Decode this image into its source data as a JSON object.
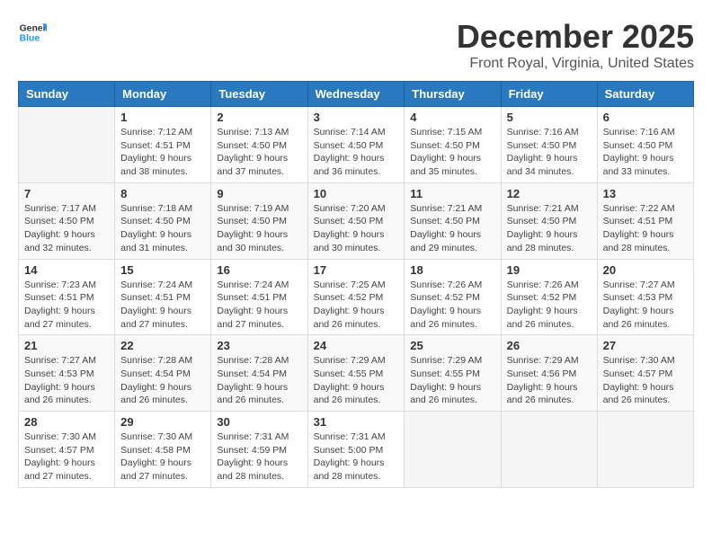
{
  "header": {
    "logo_general": "General",
    "logo_blue": "Blue",
    "month": "December 2025",
    "location": "Front Royal, Virginia, United States"
  },
  "weekdays": [
    "Sunday",
    "Monday",
    "Tuesday",
    "Wednesday",
    "Thursday",
    "Friday",
    "Saturday"
  ],
  "weeks": [
    [
      {
        "day": "",
        "info": ""
      },
      {
        "day": "1",
        "info": "Sunrise: 7:12 AM\nSunset: 4:51 PM\nDaylight: 9 hours\nand 38 minutes."
      },
      {
        "day": "2",
        "info": "Sunrise: 7:13 AM\nSunset: 4:50 PM\nDaylight: 9 hours\nand 37 minutes."
      },
      {
        "day": "3",
        "info": "Sunrise: 7:14 AM\nSunset: 4:50 PM\nDaylight: 9 hours\nand 36 minutes."
      },
      {
        "day": "4",
        "info": "Sunrise: 7:15 AM\nSunset: 4:50 PM\nDaylight: 9 hours\nand 35 minutes."
      },
      {
        "day": "5",
        "info": "Sunrise: 7:16 AM\nSunset: 4:50 PM\nDaylight: 9 hours\nand 34 minutes."
      },
      {
        "day": "6",
        "info": "Sunrise: 7:16 AM\nSunset: 4:50 PM\nDaylight: 9 hours\nand 33 minutes."
      }
    ],
    [
      {
        "day": "7",
        "info": "Sunrise: 7:17 AM\nSunset: 4:50 PM\nDaylight: 9 hours\nand 32 minutes."
      },
      {
        "day": "8",
        "info": "Sunrise: 7:18 AM\nSunset: 4:50 PM\nDaylight: 9 hours\nand 31 minutes."
      },
      {
        "day": "9",
        "info": "Sunrise: 7:19 AM\nSunset: 4:50 PM\nDaylight: 9 hours\nand 30 minutes."
      },
      {
        "day": "10",
        "info": "Sunrise: 7:20 AM\nSunset: 4:50 PM\nDaylight: 9 hours\nand 30 minutes."
      },
      {
        "day": "11",
        "info": "Sunrise: 7:21 AM\nSunset: 4:50 PM\nDaylight: 9 hours\nand 29 minutes."
      },
      {
        "day": "12",
        "info": "Sunrise: 7:21 AM\nSunset: 4:50 PM\nDaylight: 9 hours\nand 28 minutes."
      },
      {
        "day": "13",
        "info": "Sunrise: 7:22 AM\nSunset: 4:51 PM\nDaylight: 9 hours\nand 28 minutes."
      }
    ],
    [
      {
        "day": "14",
        "info": "Sunrise: 7:23 AM\nSunset: 4:51 PM\nDaylight: 9 hours\nand 27 minutes."
      },
      {
        "day": "15",
        "info": "Sunrise: 7:24 AM\nSunset: 4:51 PM\nDaylight: 9 hours\nand 27 minutes."
      },
      {
        "day": "16",
        "info": "Sunrise: 7:24 AM\nSunset: 4:51 PM\nDaylight: 9 hours\nand 27 minutes."
      },
      {
        "day": "17",
        "info": "Sunrise: 7:25 AM\nSunset: 4:52 PM\nDaylight: 9 hours\nand 26 minutes."
      },
      {
        "day": "18",
        "info": "Sunrise: 7:26 AM\nSunset: 4:52 PM\nDaylight: 9 hours\nand 26 minutes."
      },
      {
        "day": "19",
        "info": "Sunrise: 7:26 AM\nSunset: 4:52 PM\nDaylight: 9 hours\nand 26 minutes."
      },
      {
        "day": "20",
        "info": "Sunrise: 7:27 AM\nSunset: 4:53 PM\nDaylight: 9 hours\nand 26 minutes."
      }
    ],
    [
      {
        "day": "21",
        "info": "Sunrise: 7:27 AM\nSunset: 4:53 PM\nDaylight: 9 hours\nand 26 minutes."
      },
      {
        "day": "22",
        "info": "Sunrise: 7:28 AM\nSunset: 4:54 PM\nDaylight: 9 hours\nand 26 minutes."
      },
      {
        "day": "23",
        "info": "Sunrise: 7:28 AM\nSunset: 4:54 PM\nDaylight: 9 hours\nand 26 minutes."
      },
      {
        "day": "24",
        "info": "Sunrise: 7:29 AM\nSunset: 4:55 PM\nDaylight: 9 hours\nand 26 minutes."
      },
      {
        "day": "25",
        "info": "Sunrise: 7:29 AM\nSunset: 4:55 PM\nDaylight: 9 hours\nand 26 minutes."
      },
      {
        "day": "26",
        "info": "Sunrise: 7:29 AM\nSunset: 4:56 PM\nDaylight: 9 hours\nand 26 minutes."
      },
      {
        "day": "27",
        "info": "Sunrise: 7:30 AM\nSunset: 4:57 PM\nDaylight: 9 hours\nand 26 minutes."
      }
    ],
    [
      {
        "day": "28",
        "info": "Sunrise: 7:30 AM\nSunset: 4:57 PM\nDaylight: 9 hours\nand 27 minutes."
      },
      {
        "day": "29",
        "info": "Sunrise: 7:30 AM\nSunset: 4:58 PM\nDaylight: 9 hours\nand 27 minutes."
      },
      {
        "day": "30",
        "info": "Sunrise: 7:31 AM\nSunset: 4:59 PM\nDaylight: 9 hours\nand 28 minutes."
      },
      {
        "day": "31",
        "info": "Sunrise: 7:31 AM\nSunset: 5:00 PM\nDaylight: 9 hours\nand 28 minutes."
      },
      {
        "day": "",
        "info": ""
      },
      {
        "day": "",
        "info": ""
      },
      {
        "day": "",
        "info": ""
      }
    ]
  ]
}
